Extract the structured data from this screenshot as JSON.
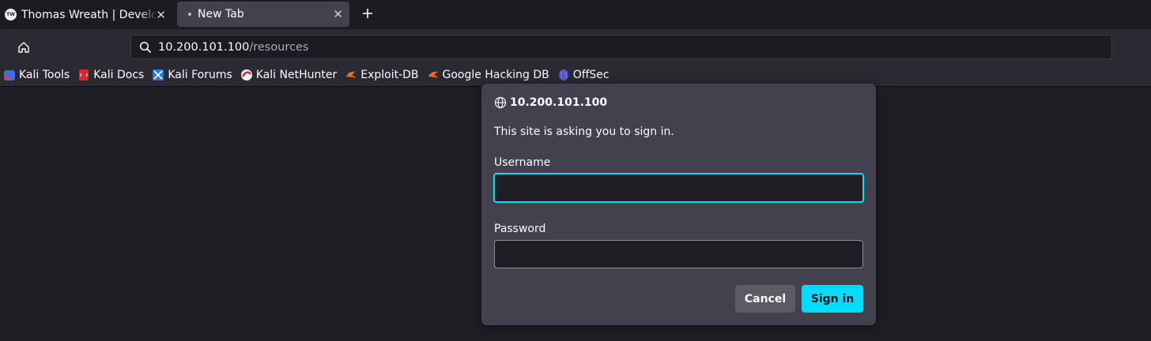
{
  "tabs": [
    {
      "title": "Thomas Wreath | Developer",
      "favicon_text": "TW",
      "active": false
    },
    {
      "title": "New Tab",
      "active": true
    }
  ],
  "urlbar": {
    "host": "10.200.101.100",
    "path": "/resources"
  },
  "bookmarks": [
    {
      "label": "Kali Tools",
      "icon": "kali-tools-icon"
    },
    {
      "label": "Kali Docs",
      "icon": "kali-docs-icon"
    },
    {
      "label": "Kali Forums",
      "icon": "kali-forums-icon"
    },
    {
      "label": "Kali NetHunter",
      "icon": "nethunter-icon"
    },
    {
      "label": "Exploit-DB",
      "icon": "exploit-db-icon"
    },
    {
      "label": "Google Hacking DB",
      "icon": "ghdb-icon"
    },
    {
      "label": "OffSec",
      "icon": "offsec-icon"
    }
  ],
  "dialog": {
    "host": "10.200.101.100",
    "message": "This site is asking you to sign in.",
    "username_label": "Username",
    "username_value": "",
    "password_label": "Password",
    "password_value": "",
    "cancel_label": "Cancel",
    "signin_label": "Sign in"
  },
  "colors": {
    "accent": "#00ddff",
    "background": "#1f1e25",
    "dialog": "#42414d"
  }
}
